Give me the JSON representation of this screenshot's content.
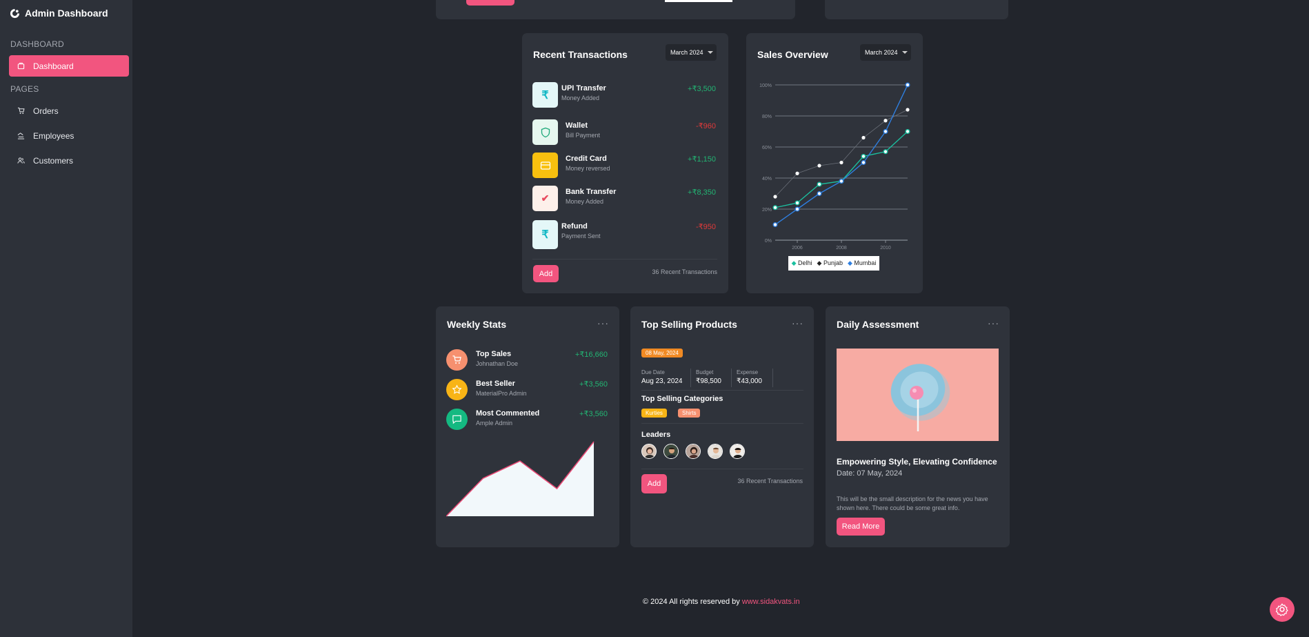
{
  "app": {
    "title": "Admin Dashboard"
  },
  "sidebar": {
    "section_dashboard": "DASHBOARD",
    "section_pages": "PAGES",
    "items": [
      {
        "label": "Dashboard"
      },
      {
        "label": "Orders"
      },
      {
        "label": "Employees"
      },
      {
        "label": "Customers"
      }
    ]
  },
  "recent_transactions": {
    "title": "Recent Transactions",
    "month": "March 2024",
    "items": [
      {
        "title": "UPI Transfer",
        "sub": "Money Added",
        "amount": "+₹3,500",
        "icon": "rupee-icon"
      },
      {
        "title": "Wallet",
        "sub": "Bill Payment",
        "amount": "-₹960",
        "icon": "shield-icon"
      },
      {
        "title": "Credit Card",
        "sub": "Money reversed",
        "amount": "+₹1,150",
        "icon": "credit-card-icon"
      },
      {
        "title": "Bank Transfer",
        "sub": "Money Added",
        "amount": "+₹8,350",
        "icon": "check-icon"
      },
      {
        "title": "Refund",
        "sub": "Payment Sent",
        "amount": "-₹950",
        "icon": "rupee-icon"
      }
    ],
    "add_label": "Add",
    "count_label": "36 Recent Transactions"
  },
  "sales_overview": {
    "title": "Sales Overview",
    "month": "March 2024"
  },
  "chart_data": {
    "type": "line",
    "x": [
      2005,
      2006,
      2007,
      2008,
      2009,
      2010,
      2011
    ],
    "x_tick_labels": [
      "2006",
      "2008",
      "2010"
    ],
    "y_tick_labels": [
      "0%",
      "20%",
      "40%",
      "60%",
      "80%",
      "100%"
    ],
    "ylim": [
      0,
      100
    ],
    "series": [
      {
        "name": "Delhi",
        "color": "#1bc0a0",
        "values": [
          21,
          24,
          36,
          38,
          54,
          57,
          70
        ]
      },
      {
        "name": "Punjab",
        "color": "#ffffff",
        "values": [
          28,
          43,
          48,
          50,
          66,
          77,
          84
        ],
        "line": false
      },
      {
        "name": "Mumbai",
        "color": "#2f7fe0",
        "values": [
          10,
          20,
          30,
          38,
          50,
          70,
          100
        ]
      }
    ],
    "legend": "bottom"
  },
  "weekly_stats": {
    "title": "Weekly Stats",
    "items": [
      {
        "title": "Top Sales",
        "sub": "Johnathan Doe",
        "amount": "+₹16,660",
        "icon": "cart-icon",
        "color": "#f6906f"
      },
      {
        "title": "Best Seller",
        "sub": "MaterialPro Admin",
        "amount": "+₹3,560",
        "icon": "star-icon",
        "color": "#f8b416"
      },
      {
        "title": "Most Commented",
        "sub": "Ample Admin",
        "amount": "+₹3,560",
        "icon": "chat-icon",
        "color": "#14b981"
      }
    ],
    "sparkline": [
      0,
      55,
      80,
      40,
      108
    ]
  },
  "top_selling": {
    "title": "Top Selling Products",
    "date_badge": "08 May, 2024",
    "due_label": "Due Date",
    "due_value": "Aug 23, 2024",
    "budget_label": "Budget",
    "budget_value": "₹98,500",
    "expense_label": "Expense",
    "expense_value": "₹43,000",
    "categories_title": "Top Selling Categories",
    "categories": [
      "Kurties",
      "Shirts"
    ],
    "leaders_title": "Leaders",
    "add_label": "Add",
    "count_label": "36 Recent Transactions"
  },
  "daily_assessment": {
    "title": "Daily Assessment",
    "headline": "Empowering Style, Elevating Confidence",
    "date": "Date: 07 May, 2024",
    "description": "This will be the small description for the news you have shown here. There could be some great info.",
    "read_more": "Read More"
  },
  "footer": {
    "text": "© 2024 All rights reserved by ",
    "link": "www.sidakvats.in"
  },
  "colors": {
    "accent": "#f2557f",
    "bg": "#22252c",
    "card": "#2f333b",
    "positive": "#22b573",
    "negative": "#e23a3a"
  }
}
